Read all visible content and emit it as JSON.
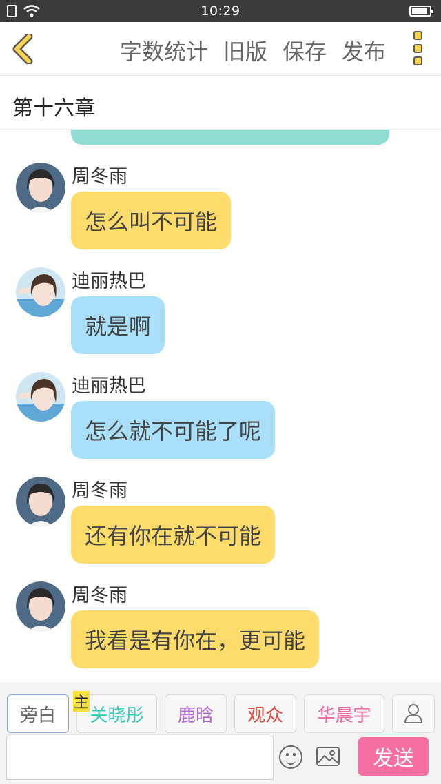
{
  "status_bar": {
    "time": "10:29"
  },
  "toolbar": {
    "actions": [
      "字数统计",
      "旧版",
      "保存",
      "发布"
    ]
  },
  "chapter": {
    "title": "第十六章"
  },
  "messages": [
    {
      "sender": "周冬雨",
      "text": "怎么叫不可能",
      "color": "#fddc6b"
    },
    {
      "sender": "迪丽热巴",
      "text": "就是啊",
      "color": "#a9dff8"
    },
    {
      "sender": "迪丽热巴",
      "text": "怎么就不可能了呢",
      "color": "#a9dff8"
    },
    {
      "sender": "周冬雨",
      "text": "还有你在就不可能",
      "color": "#fddc6b"
    },
    {
      "sender": "周冬雨",
      "text": "我看是有你在，更可能",
      "color": "#fddc6b"
    }
  ],
  "roles": [
    {
      "label": "旁白",
      "color": "#666666"
    },
    {
      "label": "关晓彤",
      "color": "#3cc9bc",
      "tag": "主"
    },
    {
      "label": "鹿晗",
      "color": "#b36ad0"
    },
    {
      "label": "观众",
      "color": "#e0443d"
    },
    {
      "label": "华晨宇",
      "color": "#f06aa0"
    }
  ],
  "input": {
    "placeholder": "",
    "send_label": "发送"
  },
  "colors": {
    "accent_send": "#f46ea2",
    "back_arrow": "#f7d34c"
  }
}
